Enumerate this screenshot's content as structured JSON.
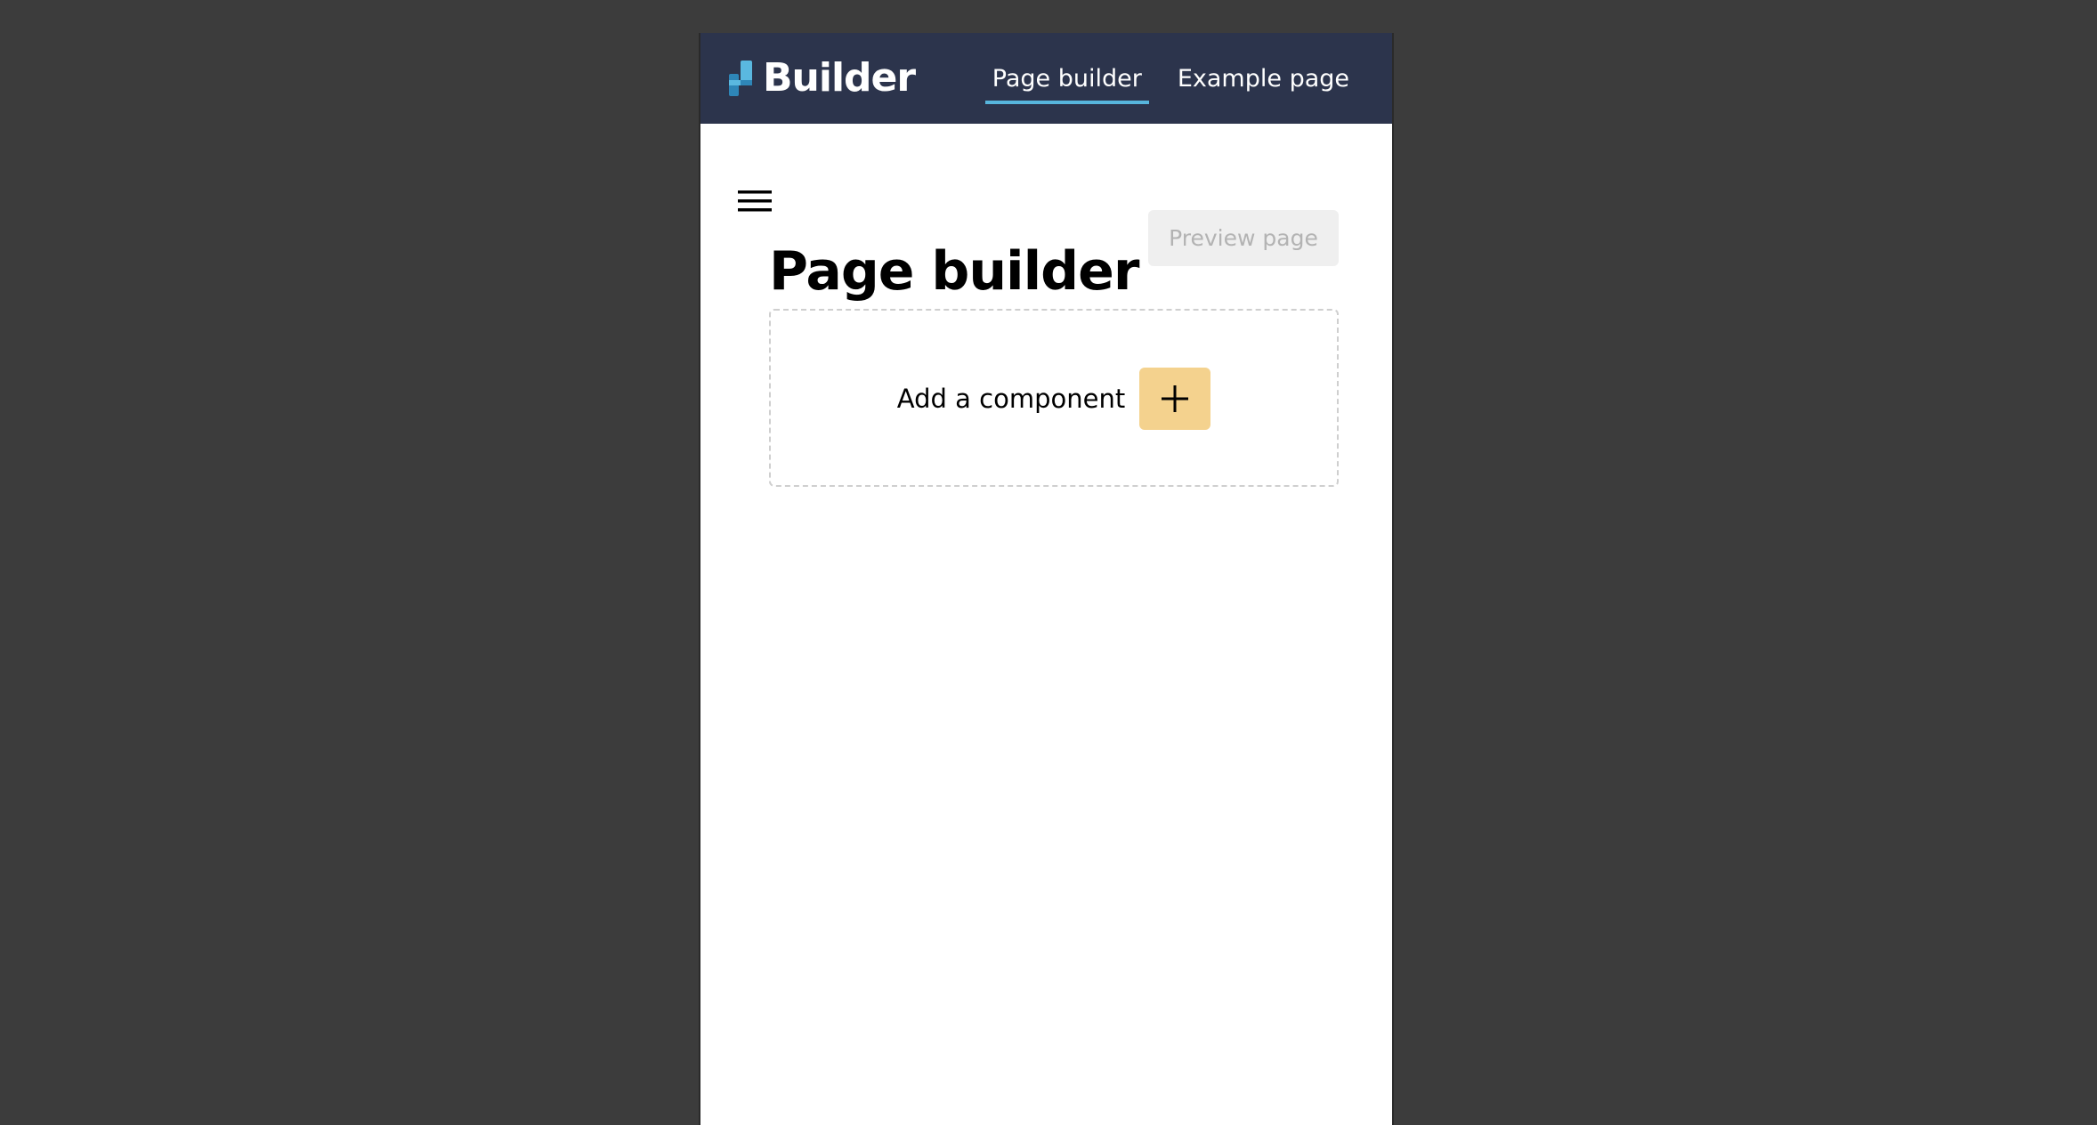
{
  "nav": {
    "brand_name": "Builder",
    "links": [
      {
        "label": "Page builder",
        "active": true
      },
      {
        "label": "Example page",
        "active": false
      }
    ]
  },
  "main": {
    "title": "Page builder",
    "preview_button": "Preview page",
    "add_component_label": "Add a component"
  },
  "icons": {
    "brand": "builder-logo-icon",
    "menu": "hamburger-menu-icon",
    "add": "plus-icon"
  },
  "colors": {
    "nav_background": "#2c344c",
    "nav_active_underline": "#57b5dc",
    "add_button": "#f4d28e",
    "preview_button_bg": "#efefef",
    "preview_button_text": "#b3b3b3",
    "outside_background": "#3c3c3c"
  }
}
